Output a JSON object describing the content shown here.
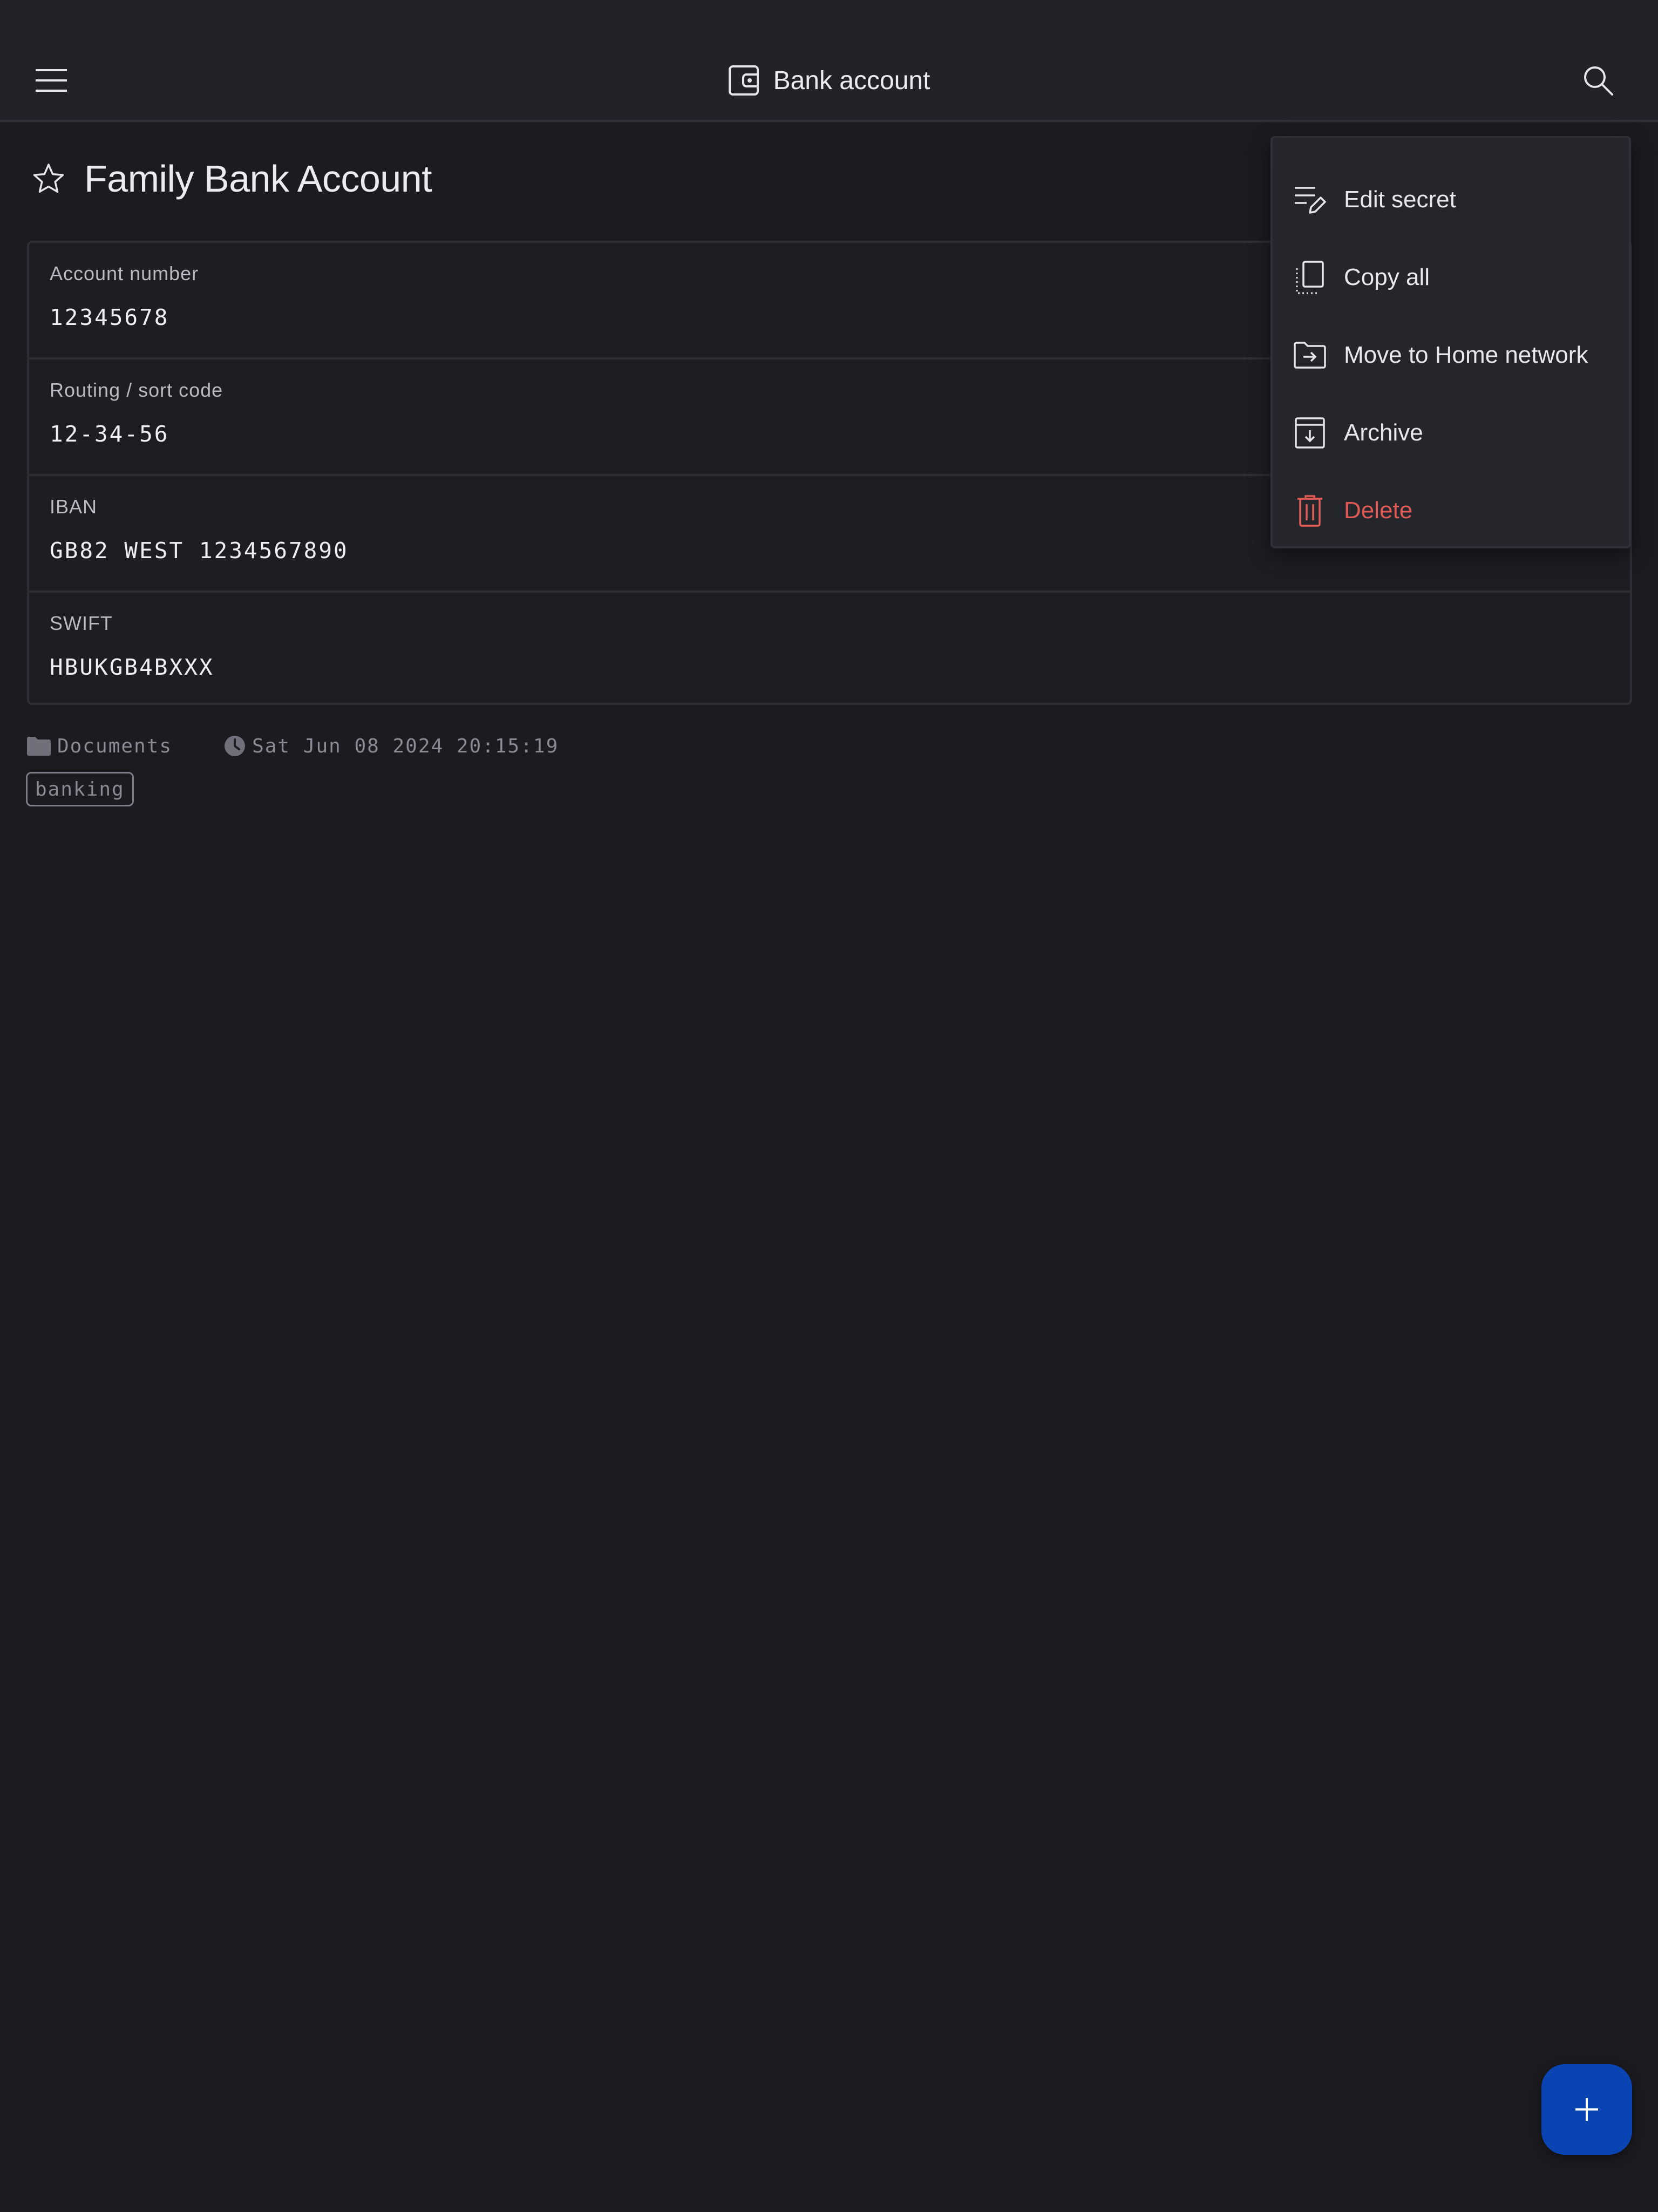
{
  "appbar": {
    "title": "Bank account",
    "menu_icon": "hamburger-menu-icon",
    "title_icon": "wallet-icon",
    "search_icon": "search-icon"
  },
  "secret": {
    "title": "Family Bank Account",
    "favorite_icon": "star-outline-icon",
    "fields": [
      {
        "label": "Account number",
        "value": "12345678"
      },
      {
        "label": "Routing / sort code",
        "value": "12-34-56"
      },
      {
        "label": "IBAN",
        "value": "GB82 WEST 1234567890"
      },
      {
        "label": "SWIFT",
        "value": "HBUKGB4BXXX"
      }
    ],
    "folder": "Documents",
    "folder_icon": "folder-icon",
    "timestamp": "Sat Jun 08 2024 20:15:19",
    "clock_icon": "clock-icon",
    "tags": [
      "banking"
    ]
  },
  "menu": {
    "items": [
      {
        "label": "Edit secret",
        "icon": "edit-list-icon"
      },
      {
        "label": "Copy all",
        "icon": "copy-icon"
      },
      {
        "label": "Move to Home network",
        "icon": "folder-move-icon"
      },
      {
        "label": "Archive",
        "icon": "archive-icon"
      },
      {
        "label": "Delete",
        "icon": "trash-icon"
      }
    ]
  },
  "fab": {
    "icon": "plus-icon"
  },
  "colors": {
    "background": "#1b1b20",
    "appbar": "#222329",
    "menu_background": "#25262c",
    "danger": "#e05a55",
    "fab": "#0a44b3"
  }
}
